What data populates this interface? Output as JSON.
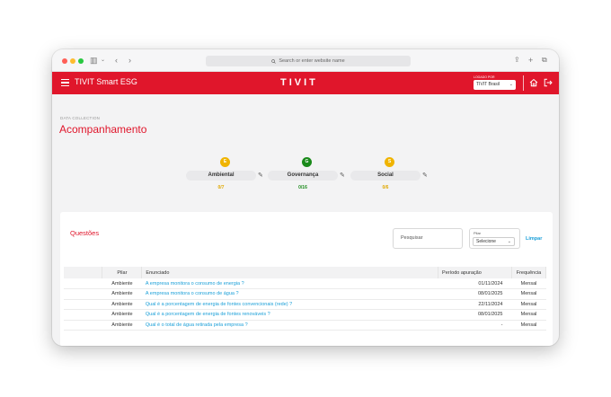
{
  "browser": {
    "address_placeholder": "Search or enter website name"
  },
  "header": {
    "hamburger_icon": "menu-icon",
    "app_title": "TIVIT Smart ESG",
    "logo_text": "TIVIT",
    "logged_as_label": "LOGADO POR",
    "org_value": "TIVIT Brasil",
    "home_icon": "home-icon",
    "logout_icon": "logout-icon",
    "brand_color": "#e0162b"
  },
  "page": {
    "breadcrumb": "DATA COLLECTION",
    "title": "Acompanhamento"
  },
  "pillars": [
    {
      "letter": "E",
      "name": "Ambiental",
      "count": "0/7",
      "badge_color": "#f0b400",
      "count_color": "#e0a800"
    },
    {
      "letter": "G",
      "name": "Governança",
      "count": "0/16",
      "badge_color": "#1a8a1a",
      "count_color": "#1a8a1a"
    },
    {
      "letter": "S",
      "name": "Social",
      "count": "0/6",
      "badge_color": "#f0b400",
      "count_color": "#e0a800"
    }
  ],
  "questions": {
    "title": "Questões",
    "search_placeholder": "Pesquisar",
    "pilar_label": "Pilar",
    "pilar_selected": "Selecione",
    "clear_label": "Limpar",
    "columns": [
      "",
      "Pilar",
      "Enunciado",
      "Período apuração",
      "Frequência"
    ],
    "rows": [
      {
        "pilar": "Ambiente",
        "enunciado": "A empresa monitora o consumo de energia ?",
        "periodo": "01/11/2024",
        "frequencia": "Mensal"
      },
      {
        "pilar": "Ambiente",
        "enunciado": "A empresa monitora o consumo de água ?",
        "periodo": "08/01/2025",
        "frequencia": "Mensal"
      },
      {
        "pilar": "Ambiente",
        "enunciado": "Qual é a porcentagem de energia de fontes convencionais (rede) ?",
        "periodo": "22/11/2024",
        "frequencia": "Mensal"
      },
      {
        "pilar": "Ambiente",
        "enunciado": "Qual é a porcentagem de energia de fontes renováveis ?",
        "periodo": "08/01/2025",
        "frequencia": "Mensal"
      },
      {
        "pilar": "Ambiente",
        "enunciado": "Qual é o total de água retirada pela empresa ?",
        "periodo": "-",
        "frequencia": "Mensal"
      }
    ]
  }
}
